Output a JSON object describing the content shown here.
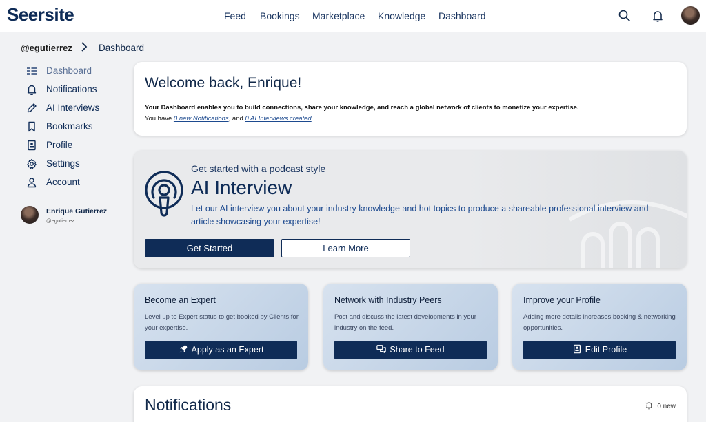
{
  "header": {
    "logo": "Seersite",
    "nav": [
      "Feed",
      "Bookings",
      "Marketplace",
      "Knowledge",
      "Dashboard"
    ]
  },
  "breadcrumb": {
    "user": "@egutierrez",
    "page": "Dashboard"
  },
  "sidebar": {
    "items": [
      {
        "label": "Dashboard",
        "icon": "dashboard-icon"
      },
      {
        "label": "Notifications",
        "icon": "bell-icon"
      },
      {
        "label": "AI Interviews",
        "icon": "pen-icon"
      },
      {
        "label": "Bookmarks",
        "icon": "bookmark-icon"
      },
      {
        "label": "Profile",
        "icon": "profile-card-icon"
      },
      {
        "label": "Settings",
        "icon": "gear-icon"
      },
      {
        "label": "Account",
        "icon": "user-icon"
      }
    ],
    "user": {
      "name": "Enrique Gutierrez",
      "handle": "@egutierrez"
    }
  },
  "welcome": {
    "title": "Welcome back, Enrique!",
    "line1": "Your Dashboard enables you to build connections, share your knowledge, and reach a global network of clients to monetize your expertise.",
    "you_have": "You have ",
    "notifications_link": "0 new Notifications",
    "and": ", and ",
    "interviews_link": "0 AI Interviews created",
    "period": "."
  },
  "podcast": {
    "kicker": "Get started with a podcast style",
    "title": "AI Interview",
    "description": "Let our AI interview you about your industry knowledge and hot topics to produce a shareable professional interview and article showcasing your expertise!",
    "primary_btn": "Get Started",
    "secondary_btn": "Learn More"
  },
  "cards": [
    {
      "title": "Become an Expert",
      "text": "Level up to Expert status to get booked by Clients for your expertise.",
      "button": "Apply as an Expert",
      "icon": "rocket-icon"
    },
    {
      "title": "Network with Industry Peers",
      "text": "Post and discuss the latest developments in your industry on the feed.",
      "button": "Share to Feed",
      "icon": "chat-icon"
    },
    {
      "title": "Improve your Profile",
      "text": "Adding more details increases booking & networking opportunities.",
      "button": "Edit Profile",
      "icon": "profile-card-icon"
    }
  ],
  "notifications": {
    "title": "Notifications",
    "count": "0 new"
  },
  "colors": {
    "brand": "#0f2c57",
    "link": "#1d4a8f",
    "card_gradient": "#b9cce2"
  }
}
